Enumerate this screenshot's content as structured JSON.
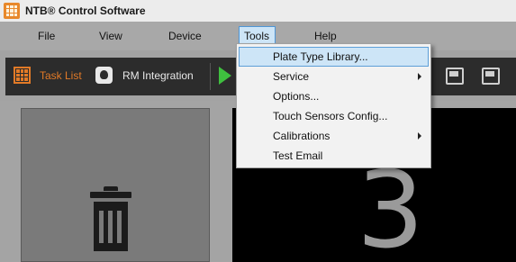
{
  "app": {
    "title": "NTB® Control Software"
  },
  "menubar": {
    "items": [
      "File",
      "View",
      "Device",
      "Tools",
      "Help"
    ]
  },
  "toolbar": {
    "task_list_label": "Task List",
    "rm_integration_label": "RM Integration"
  },
  "tools_menu": {
    "items": [
      {
        "label": "Plate Type Library...",
        "has_submenu": false
      },
      {
        "label": "Service",
        "has_submenu": true
      },
      {
        "label": "Options...",
        "has_submenu": false
      },
      {
        "label": "Touch Sensors Config...",
        "has_submenu": false
      },
      {
        "label": "Calibrations",
        "has_submenu": true
      },
      {
        "label": "Test Email",
        "has_submenu": false
      }
    ]
  },
  "display": {
    "number": "3"
  },
  "colors": {
    "accent_orange": "#e27a27",
    "play_green": "#3fbf3f",
    "highlight_blue": "#cde5f7"
  }
}
